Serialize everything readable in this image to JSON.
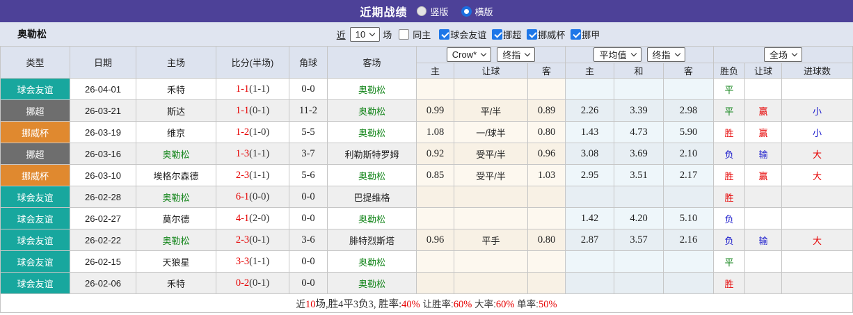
{
  "topbar": {
    "title": "近期战绩",
    "radio_vertical": "竖版",
    "radio_horizontal": "横版",
    "selected_mode": "横版"
  },
  "filter": {
    "team": "奥勒松",
    "near_label": "近",
    "near_value": "10",
    "matches_label": "场",
    "same_home_label": "同主",
    "same_home_checked": false,
    "leagues": [
      {
        "label": "球会友谊",
        "checked": true
      },
      {
        "label": "挪超",
        "checked": true
      },
      {
        "label": "挪威杯",
        "checked": true
      },
      {
        "label": "挪甲",
        "checked": true
      }
    ]
  },
  "table": {
    "static_columns": [
      "类型",
      "日期",
      "主场",
      "比分(半场)",
      "角球",
      "客场"
    ],
    "odds_group": {
      "selects": [
        "Crow*",
        "终指"
      ],
      "columns": [
        "主",
        "让球",
        "客"
      ]
    },
    "avg_group": {
      "selects": [
        "平均值",
        "终指"
      ],
      "columns": [
        "主",
        "和",
        "客"
      ]
    },
    "result_group": {
      "selects": [
        "全场"
      ],
      "columns": [
        "胜负",
        "让球",
        "进球数"
      ]
    },
    "league_colors": {
      "球会友谊": "#18a79e",
      "挪超": "#6e6e6e",
      "挪威杯": "#e0892f"
    },
    "text_colors": {
      "red": "#e60000",
      "blue": "#1a1acc",
      "green": "#15861c",
      "dark": "#333333"
    },
    "rows": [
      {
        "league": "球会友谊",
        "date": "26-04-01",
        "home": {
          "name": "禾特",
          "self": false
        },
        "score_ft": "1-1",
        "score_ht": "(1-1)",
        "corners": "0-0",
        "away": {
          "name": "奥勒松",
          "self": true
        },
        "odds": [
          "",
          "",
          ""
        ],
        "avg": [
          "",
          "",
          ""
        ],
        "results": [
          {
            "t": "平",
            "c": "green"
          },
          {
            "t": "",
            "c": ""
          },
          {
            "t": "",
            "c": ""
          }
        ]
      },
      {
        "league": "挪超",
        "date": "26-03-21",
        "home": {
          "name": "斯达",
          "self": false
        },
        "score_ft": "1-1",
        "score_ht": "(0-1)",
        "corners": "11-2",
        "away": {
          "name": "奥勒松",
          "self": true
        },
        "odds": [
          "0.99",
          "平/半",
          "0.89"
        ],
        "avg": [
          "2.26",
          "3.39",
          "2.98"
        ],
        "results": [
          {
            "t": "平",
            "c": "green"
          },
          {
            "t": "赢",
            "c": "red"
          },
          {
            "t": "小",
            "c": "blue"
          }
        ]
      },
      {
        "league": "挪威杯",
        "date": "26-03-19",
        "home": {
          "name": "维京",
          "self": false
        },
        "score_ft": "1-2",
        "score_ht": "(1-0)",
        "corners": "5-5",
        "away": {
          "name": "奥勒松",
          "self": true
        },
        "odds": [
          "1.08",
          "一/球半",
          "0.80"
        ],
        "avg": [
          "1.43",
          "4.73",
          "5.90"
        ],
        "results": [
          {
            "t": "胜",
            "c": "red"
          },
          {
            "t": "赢",
            "c": "red"
          },
          {
            "t": "小",
            "c": "blue"
          }
        ]
      },
      {
        "league": "挪超",
        "date": "26-03-16",
        "home": {
          "name": "奥勒松",
          "self": true
        },
        "score_ft": "1-3",
        "score_ht": "(1-1)",
        "corners": "3-7",
        "away": {
          "name": "利勒斯特罗姆",
          "self": false
        },
        "odds": [
          "0.92",
          "受平/半",
          "0.96"
        ],
        "avg": [
          "3.08",
          "3.69",
          "2.10"
        ],
        "results": [
          {
            "t": "负",
            "c": "blue"
          },
          {
            "t": "输",
            "c": "blue"
          },
          {
            "t": "大",
            "c": "red"
          }
        ]
      },
      {
        "league": "挪威杯",
        "date": "26-03-10",
        "home": {
          "name": "埃格尔森德",
          "self": false
        },
        "score_ft": "2-3",
        "score_ht": "(1-1)",
        "corners": "5-6",
        "away": {
          "name": "奥勒松",
          "self": true
        },
        "odds": [
          "0.85",
          "受平/半",
          "1.03"
        ],
        "avg": [
          "2.95",
          "3.51",
          "2.17"
        ],
        "results": [
          {
            "t": "胜",
            "c": "red"
          },
          {
            "t": "赢",
            "c": "red"
          },
          {
            "t": "大",
            "c": "red"
          }
        ]
      },
      {
        "league": "球会友谊",
        "date": "26-02-28",
        "home": {
          "name": "奥勒松",
          "self": true
        },
        "score_ft": "6-1",
        "score_ht": "(0-0)",
        "corners": "0-0",
        "away": {
          "name": "巴提维格",
          "self": false
        },
        "odds": [
          "",
          "",
          ""
        ],
        "avg": [
          "",
          "",
          ""
        ],
        "results": [
          {
            "t": "胜",
            "c": "red"
          },
          {
            "t": "",
            "c": ""
          },
          {
            "t": "",
            "c": ""
          }
        ]
      },
      {
        "league": "球会友谊",
        "date": "26-02-27",
        "home": {
          "name": "莫尔德",
          "self": false
        },
        "score_ft": "4-1",
        "score_ht": "(2-0)",
        "corners": "0-0",
        "away": {
          "name": "奥勒松",
          "self": true
        },
        "odds": [
          "",
          "",
          ""
        ],
        "avg": [
          "1.42",
          "4.20",
          "5.10"
        ],
        "results": [
          {
            "t": "负",
            "c": "blue"
          },
          {
            "t": "",
            "c": ""
          },
          {
            "t": "",
            "c": ""
          }
        ]
      },
      {
        "league": "球会友谊",
        "date": "26-02-22",
        "home": {
          "name": "奥勒松",
          "self": true
        },
        "score_ft": "2-3",
        "score_ht": "(0-1)",
        "corners": "3-6",
        "away": {
          "name": "腓特烈斯塔",
          "self": false
        },
        "odds": [
          "0.96",
          "平手",
          "0.80"
        ],
        "avg": [
          "2.87",
          "3.57",
          "2.16"
        ],
        "results": [
          {
            "t": "负",
            "c": "blue"
          },
          {
            "t": "输",
            "c": "blue"
          },
          {
            "t": "大",
            "c": "red"
          }
        ]
      },
      {
        "league": "球会友谊",
        "date": "26-02-15",
        "home": {
          "name": "天狼星",
          "self": false
        },
        "score_ft": "3-3",
        "score_ht": "(1-1)",
        "corners": "0-0",
        "away": {
          "name": "奥勒松",
          "self": true
        },
        "odds": [
          "",
          "",
          ""
        ],
        "avg": [
          "",
          "",
          ""
        ],
        "results": [
          {
            "t": "平",
            "c": "green"
          },
          {
            "t": "",
            "c": ""
          },
          {
            "t": "",
            "c": ""
          }
        ]
      },
      {
        "league": "球会友谊",
        "date": "26-02-06",
        "home": {
          "name": "禾特",
          "self": false
        },
        "score_ft": "0-2",
        "score_ht": "(0-1)",
        "corners": "0-0",
        "away": {
          "name": "奥勒松",
          "self": true
        },
        "odds": [
          "",
          "",
          ""
        ],
        "avg": [
          "",
          "",
          ""
        ],
        "results": [
          {
            "t": "胜",
            "c": "red"
          },
          {
            "t": "",
            "c": ""
          },
          {
            "t": "",
            "c": ""
          }
        ]
      }
    ]
  },
  "summary": {
    "segments": [
      {
        "t": "近",
        "c": "dark"
      },
      {
        "t": "10",
        "c": "red"
      },
      {
        "t": "场,胜4平3负3, 胜率:",
        "c": "dark"
      },
      {
        "t": "40%",
        "c": "red"
      },
      {
        "t": " 让胜率:",
        "c": "dark"
      },
      {
        "t": "60%",
        "c": "red"
      },
      {
        "t": " 大率:",
        "c": "dark"
      },
      {
        "t": "60%",
        "c": "red"
      },
      {
        "t": " 单率:",
        "c": "dark"
      },
      {
        "t": "50%",
        "c": "red"
      }
    ]
  }
}
